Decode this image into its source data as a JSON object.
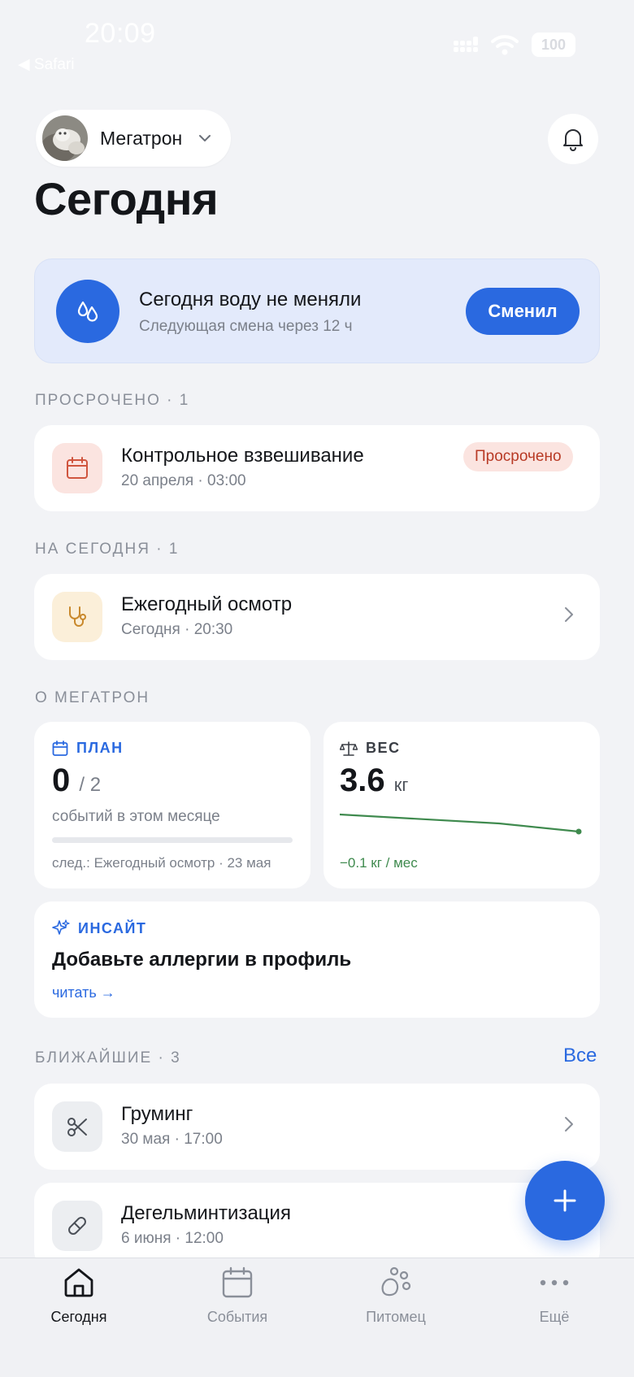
{
  "status_bar": {
    "time": "20:09",
    "back_app": "◀ Safari",
    "battery": "100"
  },
  "header": {
    "pet_name": "Мегатрон",
    "title": "Сегодня"
  },
  "water": {
    "title": "Сегодня воду не меняли",
    "subtitle": "Следующая смена через 12 ч",
    "button": "Сменил"
  },
  "overdue": {
    "label": "ПРОСРОЧЕНО · 1",
    "item": {
      "title": "Контрольное взвешивание",
      "subtitle": "20 апреля · 03:00",
      "badge": "Просрочено"
    }
  },
  "today": {
    "label": "НА СЕГОДНЯ · 1",
    "item": {
      "title": "Ежегодный осмотр",
      "subtitle": "Сегодня · 20:30"
    }
  },
  "about": {
    "label": "О МЕГАТРОН",
    "plan": {
      "label": "ПЛАН",
      "done": "0",
      "total": "/ 2",
      "done_fraction": 0,
      "caption": "событий в этом месяце",
      "next": "след.: Ежегодный осмотр · 23 мая"
    },
    "weight": {
      "label": "ВЕС",
      "value": "3.6",
      "unit": "кг",
      "trend": "−0.1 кг / мес"
    },
    "insight": {
      "label": "ИНСАЙТ",
      "title": "Добавьте аллергии в профиль",
      "link": "читать →"
    }
  },
  "upcoming": {
    "label": "БЛИЖАЙШИЕ · 3",
    "all_link": "Все",
    "items": [
      {
        "title": "Груминг",
        "subtitle": "30 мая · 17:00",
        "icon": "scissors-icon"
      },
      {
        "title": "Дегельминтизация",
        "subtitle": "6 июня · 12:00",
        "icon": "pill-icon"
      }
    ]
  },
  "tabbar": {
    "items": [
      {
        "label": "Сегодня",
        "icon": "home-icon",
        "active": true
      },
      {
        "label": "События",
        "icon": "calendar-icon",
        "active": false
      },
      {
        "label": "Питомец",
        "icon": "paw-icon",
        "active": false
      },
      {
        "label": "Ещё",
        "icon": "more-icon",
        "active": false
      }
    ]
  },
  "colors": {
    "accent": "#2a69e0",
    "danger": "#b83a25",
    "success": "#3f8a4e",
    "background": "#f2f3f6"
  }
}
